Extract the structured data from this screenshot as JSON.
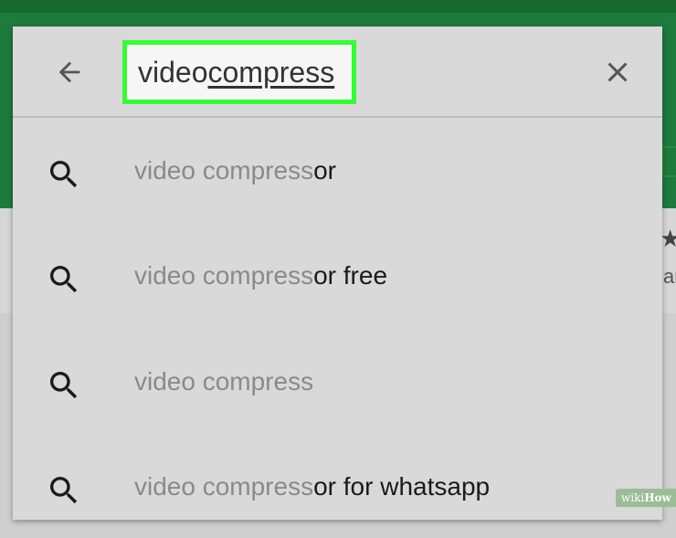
{
  "search": {
    "typed_plain": "video ",
    "typed_underlined": "compress",
    "back_icon": "arrow-left-icon",
    "clear_icon": "close-icon"
  },
  "suggestions": [
    {
      "typed": "video compress",
      "rest": "or"
    },
    {
      "typed": "video compress",
      "rest": "or free"
    },
    {
      "typed": "video compress",
      "rest": ""
    },
    {
      "typed": "video compress",
      "rest": "or for whatsapp"
    }
  ],
  "background": {
    "peek_text": "ar"
  },
  "watermark": {
    "wiki": "wiki",
    "how": "How"
  },
  "colors": {
    "app_bar": "#1e7a3d",
    "highlight_border": "#33ff33",
    "panel": "#d9d9d9"
  }
}
